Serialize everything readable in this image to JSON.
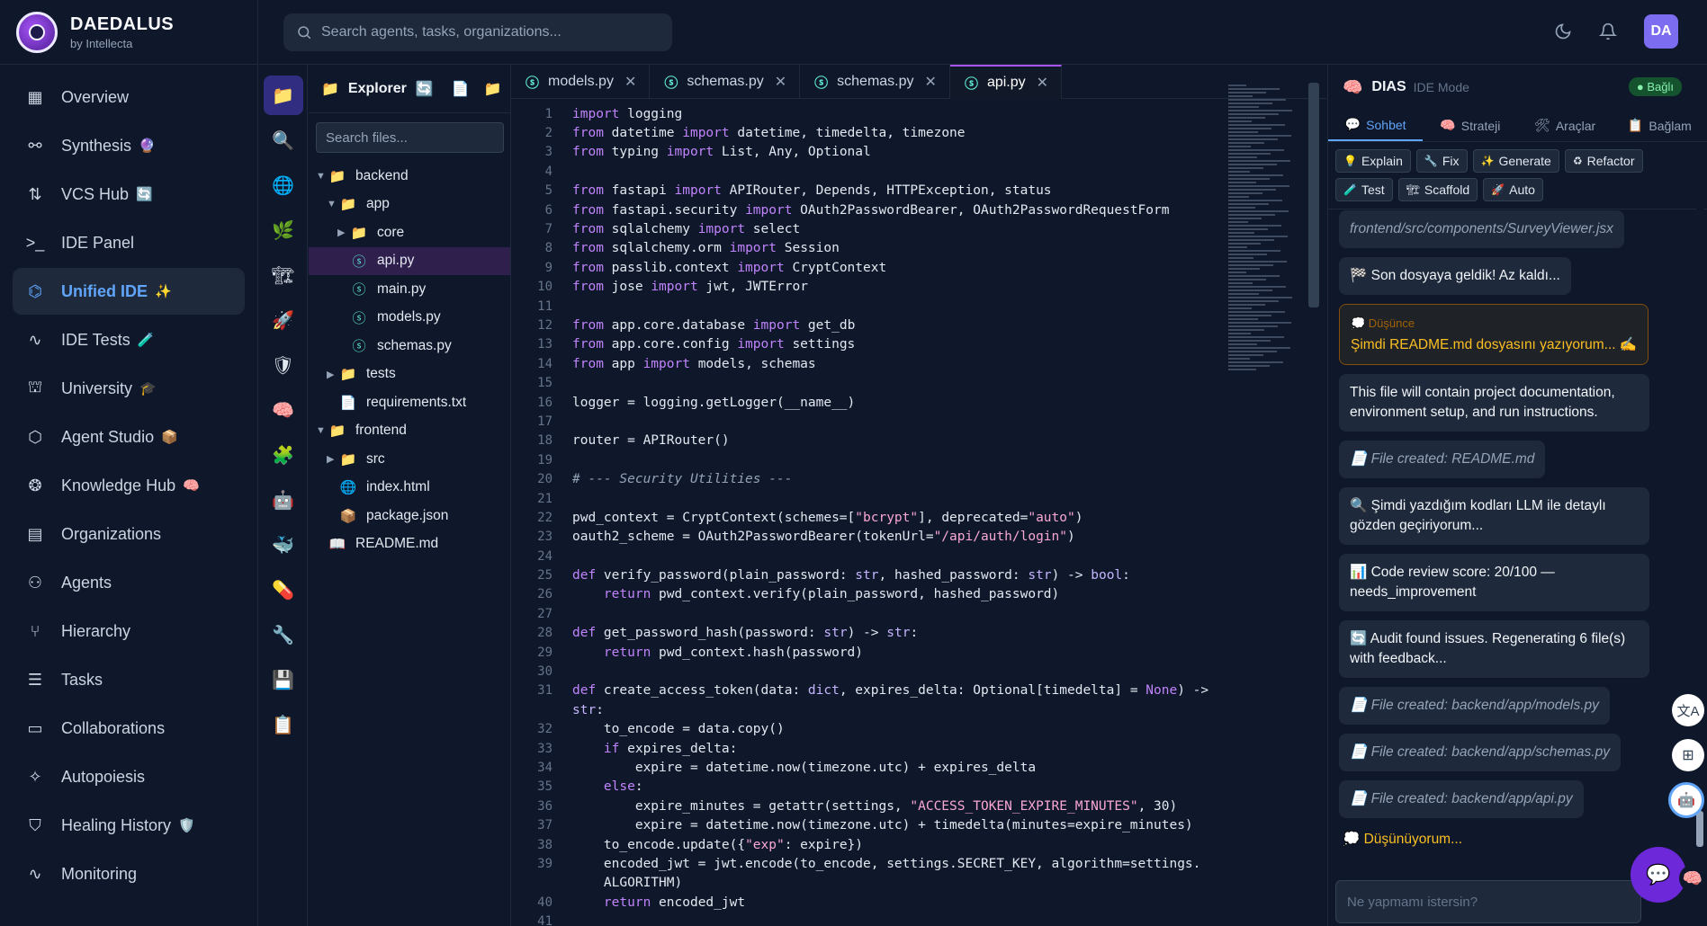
{
  "brand": {
    "name": "DAEDALUS",
    "sub": "by Intellecta"
  },
  "nav": [
    {
      "label": "Overview",
      "icon": "grid-icon",
      "emoji": ""
    },
    {
      "label": "Synthesis",
      "icon": "synthesis-icon",
      "emoji": "🔮"
    },
    {
      "label": "VCS Hub",
      "icon": "vcs-icon",
      "emoji": "🔄"
    },
    {
      "label": "IDE Panel",
      "icon": "terminal-icon",
      "emoji": ""
    },
    {
      "label": "Unified IDE",
      "icon": "cpu-icon",
      "emoji": "✨",
      "active": true
    },
    {
      "label": "IDE Tests",
      "icon": "activity-icon",
      "emoji": "🧪"
    },
    {
      "label": "University",
      "icon": "graduation-icon",
      "emoji": "🎓"
    },
    {
      "label": "Agent Studio",
      "icon": "box-icon",
      "emoji": "📦"
    },
    {
      "label": "Knowledge Hub",
      "icon": "brain-icon",
      "emoji": "🧠"
    },
    {
      "label": "Organizations",
      "icon": "building-icon",
      "emoji": ""
    },
    {
      "label": "Agents",
      "icon": "users-icon",
      "emoji": ""
    },
    {
      "label": "Hierarchy",
      "icon": "branch-icon",
      "emoji": ""
    },
    {
      "label": "Tasks",
      "icon": "list-icon",
      "emoji": ""
    },
    {
      "label": "Collaborations",
      "icon": "chat-icon",
      "emoji": ""
    },
    {
      "label": "Autopoiesis",
      "icon": "sparkle-icon",
      "emoji": ""
    },
    {
      "label": "Healing History",
      "icon": "shield-icon",
      "emoji": "🛡️"
    },
    {
      "label": "Monitoring",
      "icon": "pulse-icon",
      "emoji": ""
    }
  ],
  "search": {
    "placeholder": "Search agents, tasks, organizations..."
  },
  "user": {
    "initials": "DA"
  },
  "explorer": {
    "title": "Explorer",
    "search_placeholder": "Search files...",
    "tree": [
      {
        "label": "backend",
        "depth": 0,
        "type": "folder",
        "open": true
      },
      {
        "label": "app",
        "depth": 1,
        "type": "folder",
        "open": true
      },
      {
        "label": "core",
        "depth": 2,
        "type": "folder",
        "open": false
      },
      {
        "label": "api.py",
        "depth": 2,
        "type": "py",
        "selected": true
      },
      {
        "label": "main.py",
        "depth": 2,
        "type": "py"
      },
      {
        "label": "models.py",
        "depth": 2,
        "type": "py"
      },
      {
        "label": "schemas.py",
        "depth": 2,
        "type": "py"
      },
      {
        "label": "tests",
        "depth": 1,
        "type": "folder",
        "open": false
      },
      {
        "label": "requirements.txt",
        "depth": 1,
        "type": "txt"
      },
      {
        "label": "frontend",
        "depth": 0,
        "type": "folder",
        "open": true
      },
      {
        "label": "src",
        "depth": 1,
        "type": "folder",
        "open": false
      },
      {
        "label": "index.html",
        "depth": 1,
        "type": "html"
      },
      {
        "label": "package.json",
        "depth": 1,
        "type": "json"
      },
      {
        "label": "README.md",
        "depth": 0,
        "type": "md"
      }
    ]
  },
  "tabs": [
    {
      "label": "models.py",
      "active": false
    },
    {
      "label": "schemas.py",
      "active": false
    },
    {
      "label": "schemas.py",
      "active": false
    },
    {
      "label": "api.py",
      "active": true
    }
  ],
  "code": [
    "import logging",
    "from datetime import datetime, timedelta, timezone",
    "from typing import List, Any, Optional",
    "",
    "from fastapi import APIRouter, Depends, HTTPException, status",
    "from fastapi.security import OAuth2PasswordBearer, OAuth2PasswordRequestForm",
    "from sqlalchemy import select",
    "from sqlalchemy.orm import Session",
    "from passlib.context import CryptContext",
    "from jose import jwt, JWTError",
    "",
    "from app.core.database import get_db",
    "from app.core.config import settings",
    "from app import models, schemas",
    "",
    "logger = logging.getLogger(__name__)",
    "",
    "router = APIRouter()",
    "",
    "# --- Security Utilities ---",
    "",
    "pwd_context = CryptContext(schemes=[\"bcrypt\"], deprecated=\"auto\")",
    "oauth2_scheme = OAuth2PasswordBearer(tokenUrl=\"/api/auth/login\")",
    "",
    "def verify_password(plain_password: str, hashed_password: str) -> bool:",
    "    return pwd_context.verify(plain_password, hashed_password)",
    "",
    "def get_password_hash(password: str) -> str:",
    "    return pwd_context.hash(password)",
    "",
    "def create_access_token(data: dict, expires_delta: Optional[timedelta] = None) ->",
    "str:",
    "    to_encode = data.copy()",
    "    if expires_delta:",
    "        expire = datetime.now(timezone.utc) + expires_delta",
    "    else:",
    "        expire_minutes = getattr(settings, \"ACCESS_TOKEN_EXPIRE_MINUTES\", 30)",
    "        expire = datetime.now(timezone.utc) + timedelta(minutes=expire_minutes)",
    "    to_encode.update({\"exp\": expire})",
    "    encoded_jwt = jwt.encode(to_encode, settings.SECRET_KEY, algorithm=settings.",
    "    ALGORITHM)",
    "    return encoded_jwt",
    ""
  ],
  "line_numbers": [
    "1",
    "2",
    "3",
    "4",
    "5",
    "6",
    "7",
    "8",
    "9",
    "10",
    "11",
    "12",
    "13",
    "14",
    "15",
    "16",
    "17",
    "18",
    "19",
    "20",
    "21",
    "22",
    "23",
    "24",
    "25",
    "26",
    "27",
    "28",
    "29",
    "30",
    "31",
    "",
    "32",
    "33",
    "34",
    "35",
    "36",
    "37",
    "38",
    "39",
    "",
    "40",
    "41"
  ],
  "dias": {
    "title": "DIAS",
    "mode": "IDE Mode",
    "status": "● Bağlı",
    "tabs": [
      {
        "label": "Sohbet",
        "icon": "💬",
        "active": true
      },
      {
        "label": "Strateji",
        "icon": "🧠",
        "active": false
      },
      {
        "label": "Araçlar",
        "icon": "🛠",
        "active": false
      },
      {
        "label": "Bağlam",
        "icon": "📋",
        "active": false
      }
    ],
    "actions": [
      {
        "label": "Explain",
        "icon": "💡"
      },
      {
        "label": "Fix",
        "icon": "🔧"
      },
      {
        "label": "Generate",
        "icon": "✨"
      },
      {
        "label": "Refactor",
        "icon": "♻"
      },
      {
        "label": "Test",
        "icon": "🧪"
      },
      {
        "label": "Scaffold",
        "icon": "🏗"
      },
      {
        "label": "Auto",
        "icon": "🚀"
      }
    ],
    "messages": [
      {
        "kind": "file",
        "text": "frontend/src/components/SurveyViewer.jsx"
      },
      {
        "kind": "normal",
        "text": "🏁 Son dosyaya geldik! Az kaldı..."
      },
      {
        "kind": "think",
        "label": "💭 Düşünce",
        "text": "Şimdi README.md dosyasını yazıyorum... ✍️"
      },
      {
        "kind": "normal",
        "text": "This file will contain project documentation, environment setup, and run instructions."
      },
      {
        "kind": "file",
        "text": "📄 File created: README.md"
      },
      {
        "kind": "normal",
        "text": "🔍 Şimdi yazdığım kodları LLM ile detaylı gözden geçiriyorum..."
      },
      {
        "kind": "normal",
        "text": "📊 Code review score: 20/100 — needs_improvement"
      },
      {
        "kind": "normal",
        "text": "🔄 Audit found issues. Regenerating 6 file(s) with feedback..."
      },
      {
        "kind": "file",
        "text": "📄 File created: backend/app/models.py"
      },
      {
        "kind": "file",
        "text": "📄 File created: backend/app/schemas.py"
      },
      {
        "kind": "file",
        "text": "📄 File created: backend/app/api.py"
      }
    ],
    "thinking": "💭 Düşünüyorum...",
    "input_placeholder": "Ne yapmamı istersin?"
  },
  "colors": {
    "accent": "#60a5fa",
    "purple": "#a855f7",
    "bg": "#0f172a",
    "panel": "#1e293b"
  }
}
